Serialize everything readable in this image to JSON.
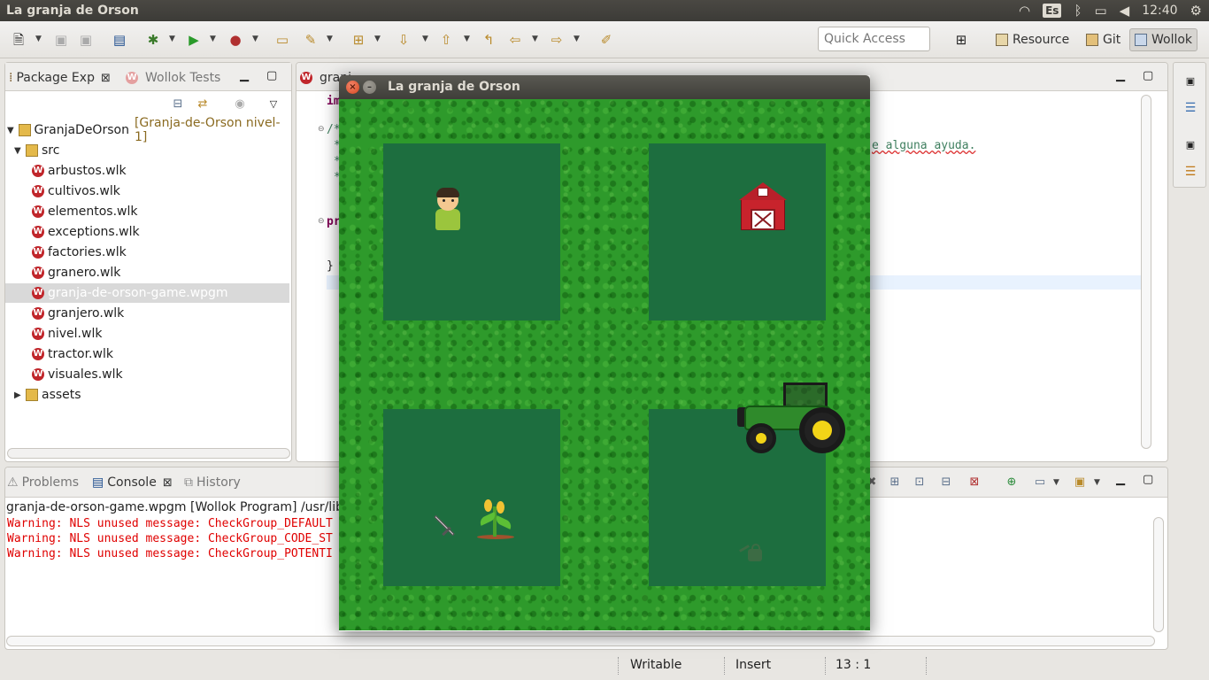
{
  "top_panel": {
    "app_title": "La granja de Orson",
    "keyboard_layout": "Es",
    "clock": "12:40"
  },
  "toolbar": {
    "quick_access_placeholder": "Quick Access",
    "perspectives": [
      "Resource",
      "Git",
      "Wollok"
    ],
    "active_perspective": "Wollok"
  },
  "package_explorer": {
    "tabs": [
      {
        "label": "Package Exp",
        "active": true
      },
      {
        "label": "Wollok Tests",
        "active": false
      }
    ],
    "tree": [
      {
        "label": "GranjaDeOrson",
        "decoration": "[Granja-de-Orson nivel-1]",
        "type": "project",
        "expanded": true
      },
      {
        "label": "src",
        "type": "folder",
        "expanded": true
      },
      {
        "label": "arbustos.wlk",
        "type": "file"
      },
      {
        "label": "cultivos.wlk",
        "type": "file"
      },
      {
        "label": "elementos.wlk",
        "type": "file"
      },
      {
        "label": "exceptions.wlk",
        "type": "file"
      },
      {
        "label": "factories.wlk",
        "type": "file"
      },
      {
        "label": "granero.wlk",
        "type": "file"
      },
      {
        "label": "granja-de-orson-game.wpgm",
        "type": "file",
        "selected": true
      },
      {
        "label": "granjero.wlk",
        "type": "file"
      },
      {
        "label": "nivel.wlk",
        "type": "file"
      },
      {
        "label": "tractor.wlk",
        "type": "file"
      },
      {
        "label": "visuales.wlk",
        "type": "file"
      },
      {
        "label": "assets",
        "type": "folder",
        "expanded": false
      }
    ]
  },
  "editor": {
    "tab_label": "granj",
    "lines": {
      "import_kw": "im",
      "comment_open": "/*",
      "comment_star": "*",
      "comment_visible": "e alguna ayuda.",
      "program_kw": "pr",
      "close_brace": "}"
    }
  },
  "console": {
    "tabs": [
      {
        "label": "Problems",
        "active": false
      },
      {
        "label": "Console",
        "active": true
      },
      {
        "label": "History",
        "active": false
      }
    ],
    "process_title": "granja-de-orson-game.wpgm [Wollok Program] /usr/lib/j",
    "warnings": [
      "Warning: NLS unused message: CheckGroup_DEFAULT",
      "Warning: NLS unused message: CheckGroup_CODE_ST",
      "Warning: NLS unused message: CheckGroup_POTENTI"
    ],
    "warning_color": "#e00000"
  },
  "status_bar": {
    "mode": "Writable",
    "insert": "Insert",
    "position": "13 : 1"
  },
  "game_window": {
    "title": "La granja de Orson",
    "grass_color": "#2e9a2b",
    "plot_color": "#1d6e3f",
    "sprites": [
      "farmer",
      "barn",
      "tractor",
      "corn",
      "sword",
      "watering-can"
    ]
  }
}
